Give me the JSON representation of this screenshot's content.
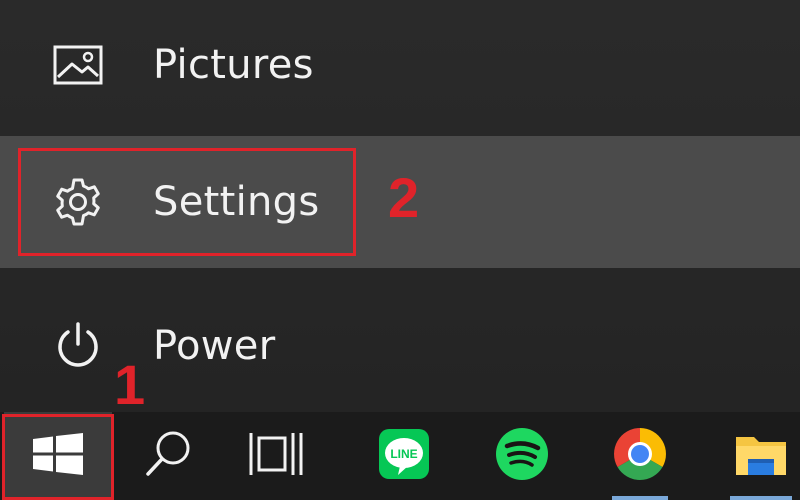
{
  "start_menu": {
    "items": [
      {
        "label": "Pictures",
        "icon": "pictures-icon"
      },
      {
        "label": "Settings",
        "icon": "gear-icon",
        "state": "hovered"
      },
      {
        "label": "Power",
        "icon": "power-icon"
      }
    ]
  },
  "annotations": {
    "step_1": "1",
    "step_2": "2",
    "highlight_color": "#e0232a"
  },
  "taskbar": {
    "buttons": [
      {
        "name": "start",
        "icon": "windows-logo-icon"
      },
      {
        "name": "search",
        "icon": "search-icon"
      },
      {
        "name": "task-view",
        "icon": "task-view-icon"
      },
      {
        "name": "line",
        "icon": "line-app-icon",
        "icon_text": "LINE"
      },
      {
        "name": "spotify",
        "icon": "spotify-icon"
      },
      {
        "name": "chrome",
        "icon": "chrome-icon"
      },
      {
        "name": "file-explorer",
        "icon": "folder-icon"
      }
    ]
  },
  "colors": {
    "menu_bg": "#262626",
    "hover_bg": "#4b4b4b",
    "taskbar_bg": "#1b1b1b",
    "running_indicator": "#7aa8d9"
  }
}
